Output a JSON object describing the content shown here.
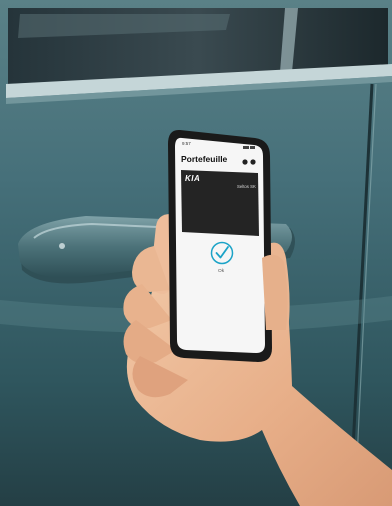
{
  "phone": {
    "status_time": "9:57",
    "app_title": "Portefeuille",
    "card": {
      "brand_logo": "KIA",
      "vehicle_name": "Seltos SK"
    },
    "confirmation": {
      "icon": "check-circle-icon",
      "label": "Ok"
    }
  },
  "colors": {
    "car_body": "#426b73",
    "card_background": "#242424",
    "accent_check": "#1ba3c7"
  }
}
